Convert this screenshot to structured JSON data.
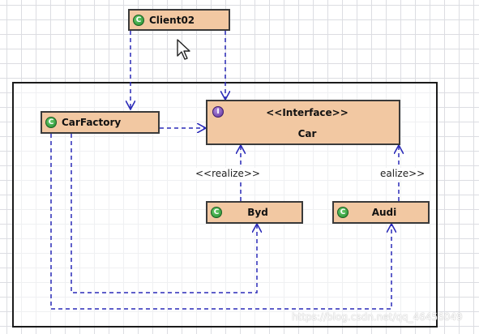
{
  "diagram": {
    "classes": {
      "client": {
        "name": "Client02",
        "icon": "class-icon"
      },
      "factory": {
        "name": "CarFactory",
        "icon": "class-icon"
      },
      "car": {
        "stereotype": "<<Interface>>",
        "name": "Car",
        "icon": "interface-icon"
      },
      "byd": {
        "name": "Byd",
        "icon": "class-icon"
      },
      "audi": {
        "name": "Audi",
        "icon": "class-icon"
      }
    },
    "relation_labels": {
      "byd_realize": "<<realize>>",
      "audi_realize": "ealize>>"
    },
    "class_icon_glyph": "C",
    "interface_icon_glyph": "I",
    "colors": {
      "class_fill": "#f2c8a2",
      "dependency_line": "#2a2ab8"
    }
  },
  "watermark": "https://blog.csdn.net/qq_46456049"
}
